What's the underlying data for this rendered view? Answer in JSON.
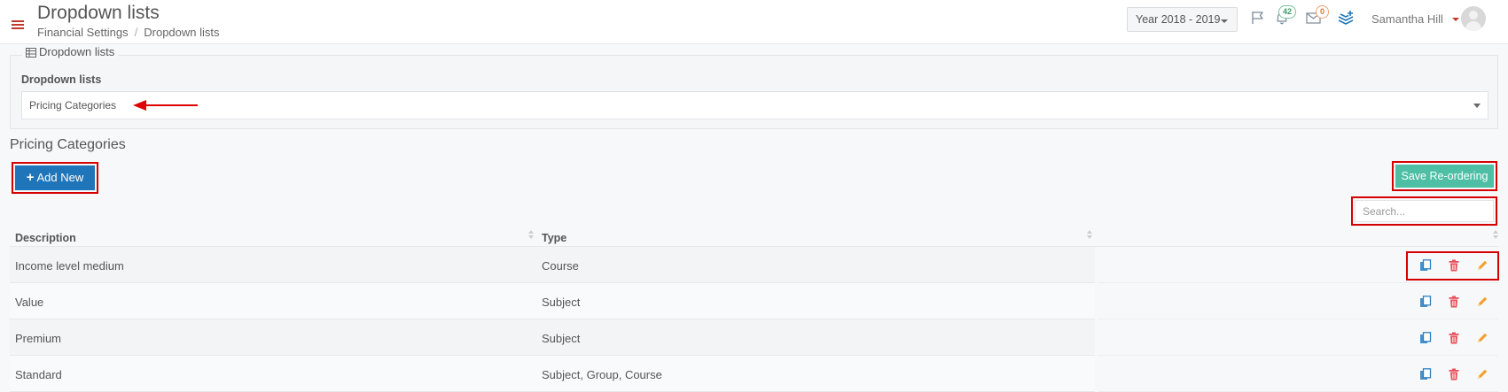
{
  "header": {
    "title": "Dropdown lists",
    "breadcrumb": [
      "Financial Settings",
      "Dropdown lists"
    ],
    "year_select": "Year 2018 - 2019",
    "notifications_count": "42",
    "messages_count": "0",
    "user_name": "Samantha Hill"
  },
  "panel": {
    "legend": "Dropdown lists",
    "label": "Dropdown lists",
    "selected_list": "Pricing Categories"
  },
  "section": {
    "title": "Pricing Categories",
    "add_label": "Add New",
    "save_label": "Save Re-ordering",
    "search_placeholder": "Search..."
  },
  "table": {
    "columns": [
      "Description",
      "Type"
    ],
    "rows": [
      {
        "description": "Income level medium",
        "type": "Course"
      },
      {
        "description": "Value",
        "type": "Subject"
      },
      {
        "description": "Premium",
        "type": "Subject"
      },
      {
        "description": "Standard",
        "type": "Subject, Group, Course"
      }
    ]
  },
  "colors": {
    "accent_blue": "#1f75b9",
    "save_green": "#4ebfa5",
    "annotation_red": "#d50000",
    "delete_red": "#e8505b",
    "edit_orange": "#f0a030"
  }
}
